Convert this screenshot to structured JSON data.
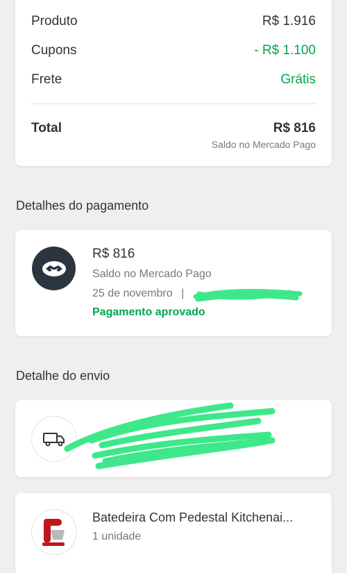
{
  "summary": {
    "product_label": "Produto",
    "product_value": "R$ 1.916",
    "coupons_label": "Cupons",
    "coupons_value": "- R$ 1.100",
    "shipping_label": "Frete",
    "shipping_value": "Grátis",
    "total_label": "Total",
    "total_value": "R$ 816",
    "total_sub": "Saldo no Mercado Pago"
  },
  "payment": {
    "section_title": "Detalhes do pagamento",
    "amount": "R$ 816",
    "method": "Saldo no Mercado Pago",
    "date": "25 de novembro",
    "separator": "|",
    "status": "Pagamento aprovado",
    "icon": "handshake-icon"
  },
  "shipping": {
    "section_title": "Detalhe do envio",
    "icon": "truck-icon"
  },
  "product": {
    "title": "Batedeira Com Pedestal Kitchenai...",
    "quantity": "1 unidade"
  },
  "colors": {
    "accent_green": "#00a650",
    "avatar_dark": "#2b3540",
    "scribble_green": "#3ee88a"
  }
}
